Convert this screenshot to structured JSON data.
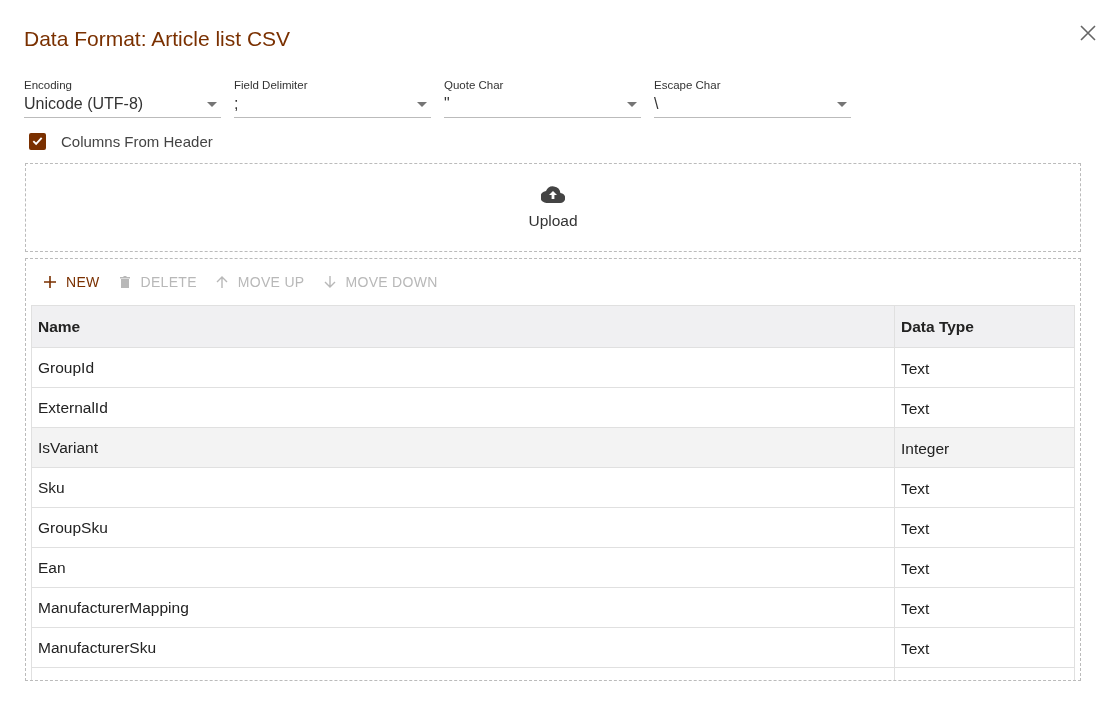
{
  "dialog": {
    "title": "Data Format: Article list CSV"
  },
  "fields": [
    {
      "label": "Encoding",
      "value": "Unicode (UTF-8)"
    },
    {
      "label": "Field Delimiter",
      "value": ";"
    },
    {
      "label": "Quote Char",
      "value": "\""
    },
    {
      "label": "Escape Char",
      "value": "\\"
    }
  ],
  "checkbox": {
    "label": "Columns From Header",
    "checked": true
  },
  "upload": {
    "label": "Upload"
  },
  "toolbar": [
    {
      "kind": "add",
      "label": "NEW",
      "disabled": false
    },
    {
      "kind": "delete",
      "label": "DELETE",
      "disabled": true
    },
    {
      "kind": "up",
      "label": "MOVE UP",
      "disabled": true
    },
    {
      "kind": "down",
      "label": "MOVE DOWN",
      "disabled": true
    }
  ],
  "table": {
    "columns": [
      "Name",
      "Data Type"
    ],
    "rows": [
      {
        "cells": [
          "GroupId",
          "Text"
        ],
        "selected": false
      },
      {
        "cells": [
          "ExternalId",
          "Text"
        ],
        "selected": false
      },
      {
        "cells": [
          "IsVariant",
          "Integer"
        ],
        "selected": true
      },
      {
        "cells": [
          "Sku",
          "Text"
        ],
        "selected": false
      },
      {
        "cells": [
          "GroupSku",
          "Text"
        ],
        "selected": false
      },
      {
        "cells": [
          "Ean",
          "Text"
        ],
        "selected": false
      },
      {
        "cells": [
          "ManufacturerMapping",
          "Text"
        ],
        "selected": false
      },
      {
        "cells": [
          "ManufacturerSku",
          "Text"
        ],
        "selected": false
      }
    ]
  }
}
